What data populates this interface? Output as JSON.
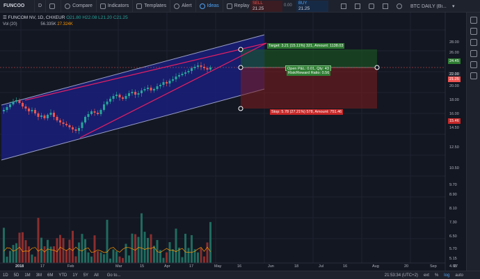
{
  "toolbar": {
    "symbol": "FUNCOO",
    "interval": "D",
    "compare": "Compare",
    "indicators": "Indicators",
    "templates": "Templates",
    "alert": "Alert",
    "ideas": "Ideas",
    "replay": "Replay",
    "sell_label": "SELL",
    "sell_price": "21.25",
    "spread": "0.00",
    "buy_label": "BUY",
    "buy_price": "21.25",
    "watchlist": "BTC DAILY (Bi..."
  },
  "legend": {
    "title": "FUNCOM NV, 1D, CHXEUR",
    "open": "O21.80",
    "high": "H22.08",
    "low": "L21.20",
    "close": "C21.25",
    "vol": "Vol (20)",
    "vol_val1": "56.335K",
    "vol_val2": "27.324K"
  },
  "price_axis": [
    "28.00",
    "26.00",
    "24.45",
    "22.00",
    "21.25",
    "20.00",
    "18.00",
    "16.00",
    "15.46",
    "14.50",
    "12.50",
    "10.50",
    "9.70",
    "8.90",
    "8.10",
    "7.30",
    "6.50",
    "5.70",
    "5.15",
    "4.65"
  ],
  "date_axis": [
    "2018",
    "17",
    "Feb",
    "Mar",
    "15",
    "Apr",
    "17",
    "May",
    "16",
    "Jun",
    "18",
    "Jul",
    "16",
    "Aug",
    "20",
    "Sep",
    "17"
  ],
  "trade": {
    "target": "Target: 3.21 (15.11%) 321, Amount: 1138.03",
    "pnl": "Open P&L: 0.01, Qty: 43",
    "rr": "Risk/Reward Ratio: 0.56",
    "stop": "Stop: 5.78 (27.21%) 578, Amount: 751.46"
  },
  "bottombar": {
    "ranges": [
      "1D",
      "5D",
      "1M",
      "3M",
      "6M",
      "YTD",
      "1Y",
      "5Y",
      "All"
    ],
    "goto": "Go to...",
    "time": "21:53:34 (UTC+2)",
    "ext": "ext",
    "pct": "%",
    "log": "log",
    "auto": "auto"
  },
  "colors": {
    "bg": "#131722",
    "up": "#26a69a",
    "down": "#ef5350",
    "channel": "#1a1f7a",
    "wedge": "#e91e63"
  }
}
